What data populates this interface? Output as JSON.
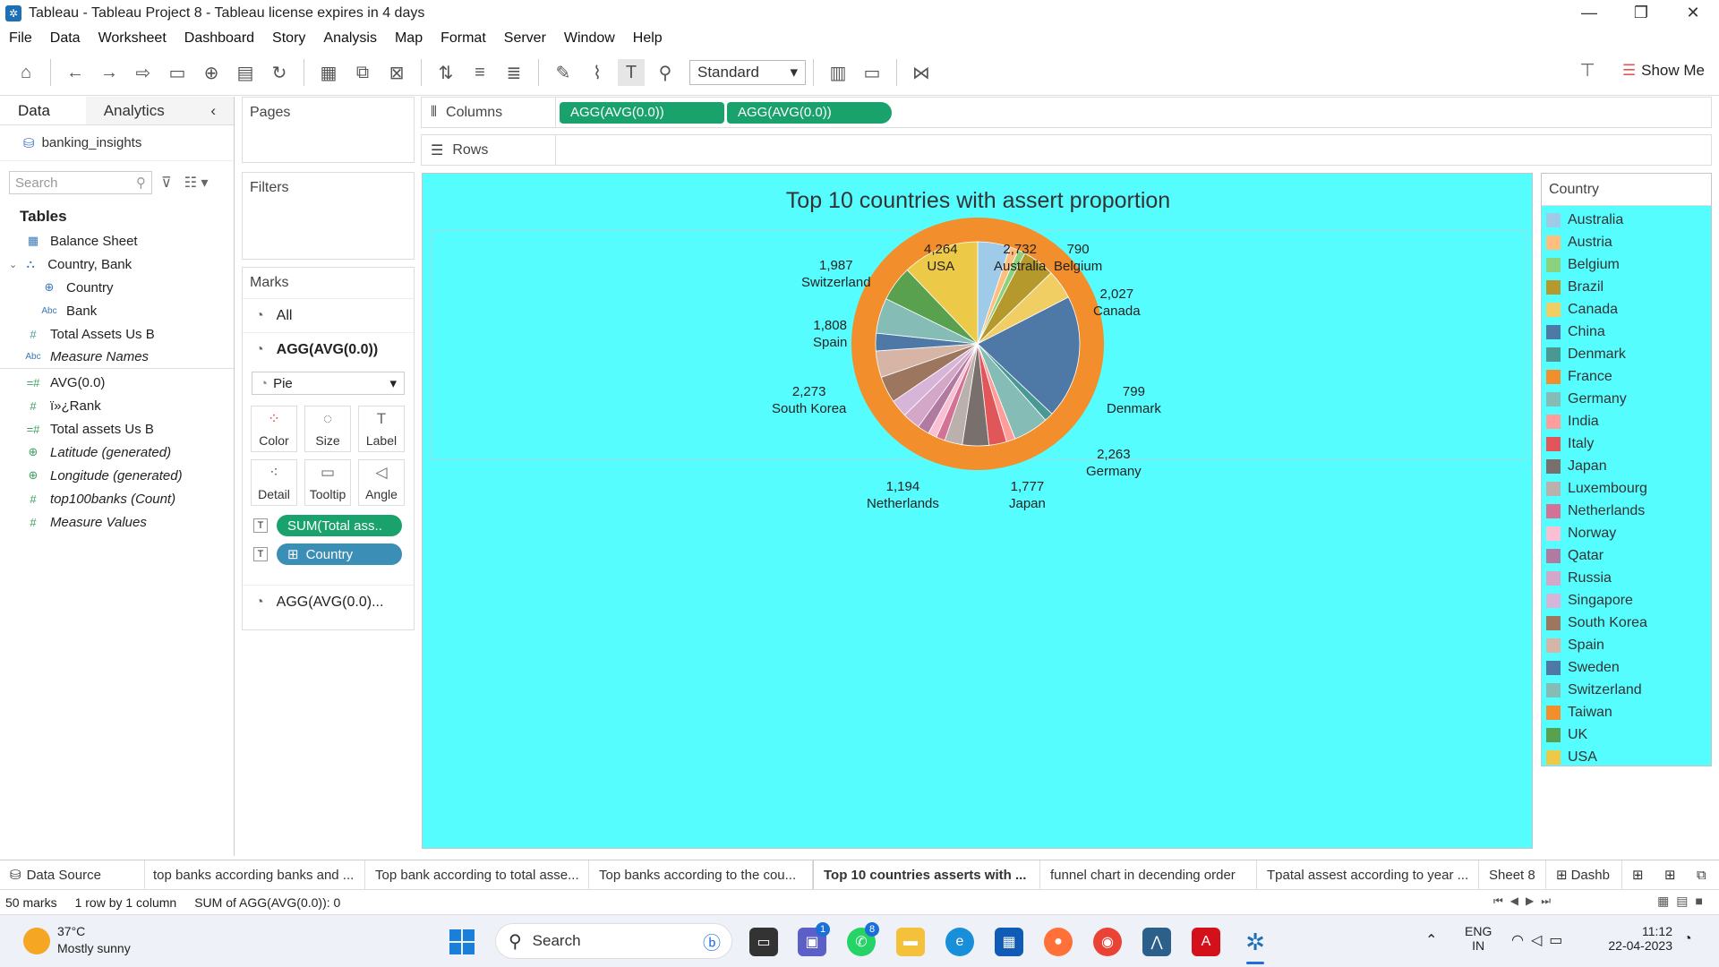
{
  "window": {
    "title": "Tableau - Tableau Project 8 - Tableau license expires in 4 days"
  },
  "menu": [
    "File",
    "Data",
    "Worksheet",
    "Dashboard",
    "Story",
    "Analysis",
    "Map",
    "Format",
    "Server",
    "Window",
    "Help"
  ],
  "toolbar": {
    "fit": "Standard",
    "show_me": "Show Me"
  },
  "left": {
    "tab_data": "Data",
    "tab_analytics": "Analytics",
    "datasource": "banking_insights",
    "search_placeholder": "Search",
    "tables_header": "Tables",
    "fields": [
      {
        "name": "Balance Sheet",
        "icon": "table-icon",
        "italic": false
      },
      {
        "name": "Country, Bank",
        "icon": "hierarchy-icon",
        "italic": false
      },
      {
        "name": "Country",
        "icon": "globe-icon",
        "italic": false
      },
      {
        "name": "Bank",
        "icon": "abc-icon",
        "italic": false
      },
      {
        "name": "Total Assets Us B",
        "icon": "hash-icon",
        "italic": false
      },
      {
        "name": "Measure Names",
        "icon": "abc-icon",
        "italic": true
      },
      {
        "name": "AVG(0.0)",
        "icon": "calc-hash-icon",
        "italic": false
      },
      {
        "name": "ï»¿Rank",
        "icon": "hash-icon",
        "italic": false
      },
      {
        "name": "Total assets Us B",
        "icon": "calc-hash-icon",
        "italic": false
      },
      {
        "name": "Latitude (generated)",
        "icon": "globe-icon",
        "italic": true
      },
      {
        "name": "Longitude (generated)",
        "icon": "globe-icon",
        "italic": true
      },
      {
        "name": "top100banks (Count)",
        "icon": "hash-icon",
        "italic": true
      },
      {
        "name": "Measure Values",
        "icon": "hash-icon",
        "italic": true
      }
    ]
  },
  "cards": {
    "pages": "Pages",
    "filters": "Filters",
    "marks": "Marks",
    "marks_all": "All",
    "marks_agg": "AGG(AVG(0.0))",
    "mark_type": "Pie",
    "buttons": [
      "Color",
      "Size",
      "Label",
      "Detail",
      "Tooltip",
      "Angle"
    ],
    "pill_sum": "SUM(Total ass..",
    "pill_country": "Country",
    "marks_agg2": "AGG(AVG(0.0)..."
  },
  "shelves": {
    "columns_label": "Columns",
    "rows_label": "Rows",
    "col_pill_1": "AGG(AVG(0.0))",
    "col_pill_2": "AGG(AVG(0.0))"
  },
  "chart_data": {
    "type": "pie",
    "title": "Top 10 countries with assert proportion",
    "labeled_slices": [
      {
        "country": "USA",
        "value": "4,264"
      },
      {
        "country": "Australia",
        "value": "2,732"
      },
      {
        "country": "Belgium",
        "value": "790"
      },
      {
        "country": "Canada",
        "value": "2,027"
      },
      {
        "country": "Denmark",
        "value": "799"
      },
      {
        "country": "Germany",
        "value": "2,263"
      },
      {
        "country": "Japan",
        "value": "1,777"
      },
      {
        "country": "Netherlands",
        "value": "1,194"
      },
      {
        "country": "South Korea",
        "value": "2,273"
      },
      {
        "country": "Spain",
        "value": "1,808"
      },
      {
        "country": "Switzerland",
        "value": "1,987"
      }
    ],
    "inner_slices": [
      {
        "country": "Australia",
        "value": 0.055
      },
      {
        "country": "Austria",
        "value": 0.015
      },
      {
        "country": "Belgium",
        "value": 0.012
      },
      {
        "country": "Brazil",
        "value": 0.055
      },
      {
        "country": "Canada",
        "value": 0.05
      },
      {
        "country": "China",
        "value": 0.21
      },
      {
        "country": "Denmark",
        "value": 0.015
      },
      {
        "country": "Germany",
        "value": 0.06
      },
      {
        "country": "India",
        "value": 0.015
      },
      {
        "country": "Italy",
        "value": 0.03
      },
      {
        "country": "Japan",
        "value": 0.045
      },
      {
        "country": "Luxembourg",
        "value": 0.03
      },
      {
        "country": "Netherlands",
        "value": 0.015
      },
      {
        "country": "Norway",
        "value": 0.015
      },
      {
        "country": "Qatar",
        "value": 0.02
      },
      {
        "country": "Russia",
        "value": 0.03
      },
      {
        "country": "Singapore",
        "value": 0.03
      },
      {
        "country": "South Korea",
        "value": 0.045
      },
      {
        "country": "Spain",
        "value": 0.045
      },
      {
        "country": "Sweden",
        "value": 0.03
      },
      {
        "country": "Switzerland",
        "value": 0.06
      },
      {
        "country": "UK",
        "value": 0.06
      },
      {
        "country": "USA",
        "value": 0.13
      }
    ],
    "outer_ring_color": "#f28e2b"
  },
  "legend": {
    "title": "Country",
    "items": [
      {
        "name": "Australia",
        "color": "#a0cbe8"
      },
      {
        "name": "Austria",
        "color": "#ffbe7d"
      },
      {
        "name": "Belgium",
        "color": "#8cd17d"
      },
      {
        "name": "Brazil",
        "color": "#b6992d"
      },
      {
        "name": "Canada",
        "color": "#f1ce63"
      },
      {
        "name": "China",
        "color": "#4e79a7"
      },
      {
        "name": "Denmark",
        "color": "#499894"
      },
      {
        "name": "France",
        "color": "#f28e2b"
      },
      {
        "name": "Germany",
        "color": "#86bcb6"
      },
      {
        "name": "India",
        "color": "#ff9d9a"
      },
      {
        "name": "Italy",
        "color": "#e15759"
      },
      {
        "name": "Japan",
        "color": "#79706e"
      },
      {
        "name": "Luxembourg",
        "color": "#bab0ac"
      },
      {
        "name": "Netherlands",
        "color": "#d37295"
      },
      {
        "name": "Norway",
        "color": "#fabfd2"
      },
      {
        "name": "Qatar",
        "color": "#b07aa1"
      },
      {
        "name": "Russia",
        "color": "#d4a6c8"
      },
      {
        "name": "Singapore",
        "color": "#d7b5d8"
      },
      {
        "name": "South Korea",
        "color": "#9d7660"
      },
      {
        "name": "Spain",
        "color": "#d7b5a6"
      },
      {
        "name": "Sweden",
        "color": "#4e79a7"
      },
      {
        "name": "Switzerland",
        "color": "#86bcb6"
      },
      {
        "name": "Taiwan",
        "color": "#f28e2b"
      },
      {
        "name": "UK",
        "color": "#59a14f"
      },
      {
        "name": "USA",
        "color": "#edc948"
      }
    ]
  },
  "sheet_tabs": [
    {
      "label": "Data Source",
      "active": false
    },
    {
      "label": "top banks according banks and ...",
      "active": false
    },
    {
      "label": "Top bank according to total asse...",
      "active": false
    },
    {
      "label": "Top banks according to the cou...",
      "active": false
    },
    {
      "label": "Top 10 countries asserts with ...",
      "active": true
    },
    {
      "label": "funnel chart in decending order",
      "active": false
    },
    {
      "label": "Tpatal assest according to year ...",
      "active": false
    },
    {
      "label": "Sheet 8",
      "active": false
    },
    {
      "label": "Dashb",
      "active": false
    }
  ],
  "status": {
    "marks": "50 marks",
    "rows": "1 row by 1 column",
    "sum": "SUM of AGG(AVG(0.0)): 0"
  },
  "taskbar": {
    "weather_temp": "37°C",
    "weather_desc": "Mostly sunny",
    "search": "Search",
    "lang1": "ENG",
    "lang2": "IN",
    "time": "11:12",
    "date": "22-04-2023",
    "badge_teams": "1",
    "badge_whatsapp": "8"
  }
}
